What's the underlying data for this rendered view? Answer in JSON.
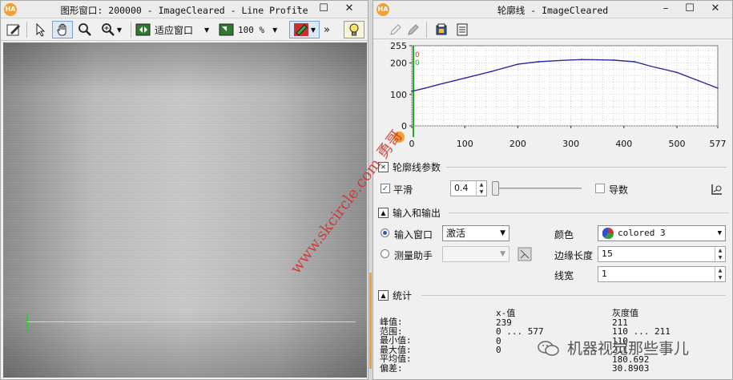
{
  "left_window": {
    "title": "图形窗口: 200000 - ImageCleared - Line Profile",
    "app_logo": "HA",
    "minimize": "–",
    "maximize": "☐",
    "close": "✕",
    "toolbar": {
      "fit_label": "适应窗口",
      "zoom_label": "100 %",
      "more": "»"
    },
    "icons": [
      "edit-icon",
      "pointer-icon",
      "hand-icon",
      "magnifier-icon",
      "zoom-in-icon",
      "fit-window-icon",
      "zoom-icon",
      "color-icon",
      "lightbulb-icon"
    ]
  },
  "right_window": {
    "title": "轮廓线 - ImageCleared",
    "app_logo": "HA",
    "minimize": "–",
    "maximize": "☐",
    "close": "✕",
    "section_profile_params": "轮廓线参数",
    "smooth_label": "平滑",
    "smooth_checked": true,
    "smooth_value": "0.4",
    "smooth_fraction": 0.02,
    "derivative_label": "导数",
    "derivative_checked": false,
    "section_io": "输入和输出",
    "input_window_label": "输入窗口",
    "input_window_value": "激活",
    "measure_assistant_label": "测量助手",
    "color_label": "颜色",
    "color_value": "colored 3",
    "edge_length_label": "边缘长度",
    "edge_length_value": "15",
    "line_width_label": "线宽",
    "line_width_value": "1",
    "section_stats": "统计",
    "stats": {
      "header_x": "x-值",
      "header_gray": "灰度值",
      "rows": [
        {
          "label": "峰值:",
          "x": "239",
          "gray": "211"
        },
        {
          "label": "范围:",
          "x": "0 ... 577",
          "gray": "110 ... 211"
        },
        {
          "label": "最小值:",
          "x": "0",
          "gray": "110"
        },
        {
          "label": "最大值:",
          "x": "0",
          "gray": "211"
        },
        {
          "label": "平均值:",
          "x": "",
          "gray": "180.692"
        },
        {
          "label": "偏差:",
          "x": "",
          "gray": "30.8903"
        }
      ]
    }
  },
  "chart_data": {
    "type": "line",
    "title": "",
    "xlabel": "",
    "ylabel": "",
    "xlim": [
      0,
      577
    ],
    "ylim": [
      0,
      255
    ],
    "x_ticks": [
      "0",
      "100",
      "200",
      "300",
      "400",
      "500",
      "577"
    ],
    "y_ticks": [
      "255",
      "200",
      "100",
      "0"
    ],
    "marker_labels": [
      "0",
      "0"
    ],
    "grid": true,
    "series": [
      {
        "color": "#2a2a9a",
        "x": [
          0,
          25,
          50,
          100,
          150,
          200,
          239,
          280,
          320,
          350,
          380,
          420,
          450,
          500,
          540,
          577
        ],
        "y": [
          110,
          120,
          131,
          152,
          173,
          196,
          204,
          208,
          211,
          210,
          209,
          204,
          190,
          170,
          144,
          120
        ]
      }
    ],
    "start_marker_color": "#22aa22"
  },
  "watermark": "www.skcircle.com 勇哥",
  "wechat_caption": "机器视觉那些事儿"
}
